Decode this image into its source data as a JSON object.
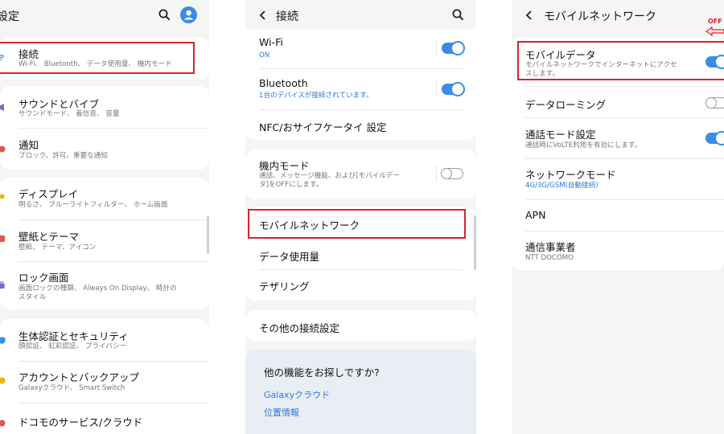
{
  "panel1": {
    "header": {
      "title": "設定"
    },
    "items": [
      {
        "title": "接続",
        "sub": "Wi-Fi、 Bluetooth、 データ使用量、 機内モード"
      },
      {
        "title": "サウンドとバイブ",
        "sub": "サウンドモード、 着信音、 音量"
      },
      {
        "title": "通知",
        "sub": "ブロック、許可、重要な通知"
      },
      {
        "title": "ディスプレイ",
        "sub": "明るさ、 ブルーライトフィルター、 ホーム画面"
      },
      {
        "title": "壁紙とテーマ",
        "sub": "壁紙、 テーマ、アイコン"
      },
      {
        "title": "ロック画面",
        "sub": "画面ロックの種類、 Always On Display、 時計の",
        "sub2": "スタイル"
      },
      {
        "title": "生体認証とセキュリティ",
        "sub": "顔認証、 虹彩認証、 プライバシー"
      },
      {
        "title": "アカウントとバックアップ",
        "sub": "Galaxyクラウド、 Smart Switch"
      },
      {
        "title": "ドコモのサービス/クラウド",
        "sub": ""
      }
    ]
  },
  "panel2": {
    "header": {
      "title": "接続"
    },
    "items": [
      {
        "title": "Wi-Fi",
        "sub": "ON",
        "toggle": "on"
      },
      {
        "title": "Bluetooth",
        "sub": "1台のデバイスが接続されています。",
        "toggle": "on"
      },
      {
        "title": "NFC/おサイフケータイ 設定"
      },
      {
        "title": "機内モード",
        "sub": "通話、メッセージ機能、および[モバイルデー",
        "sub2": "タ]をOFFにします。",
        "toggle": "off"
      },
      {
        "title": "モバイルネットワーク"
      },
      {
        "title": "データ使用量"
      },
      {
        "title": "テザリング"
      },
      {
        "title": "その他の接続設定"
      }
    ],
    "more": {
      "title": "他の機能をお探しですか?",
      "links": [
        "Galaxyクラウド",
        "位置情報"
      ]
    }
  },
  "panel3": {
    "header": {
      "title": "モバイルネットワーク"
    },
    "off_label": "OFF",
    "items": [
      {
        "title": "モバイルデータ",
        "sub": "モバイルネットワークでインターネットにアクセ",
        "sub2": "スします。",
        "toggle": "on"
      },
      {
        "title": "データローミング",
        "toggle": "off"
      },
      {
        "title": "通話モード設定",
        "sub": "通話時にVoLTE利用を有効にします。",
        "toggle": "on"
      },
      {
        "title": "ネットワークモード",
        "sub": "4G/3G/GSM(自動接続)"
      },
      {
        "title": "APN"
      },
      {
        "title": "通信事業者",
        "sub": "NTT DOCOMO"
      }
    ]
  },
  "colors": {
    "highlight": "#d8232a",
    "toggle_on": "#3b8ce4",
    "link": "#2878d8"
  },
  "icons": {
    "panel1_header": [
      "search-icon",
      "account-icon"
    ],
    "panel2_header": [
      "back-icon",
      "search-icon"
    ],
    "panel3_header": [
      "back-icon"
    ],
    "off_arrow": "arrow-left-icon"
  }
}
